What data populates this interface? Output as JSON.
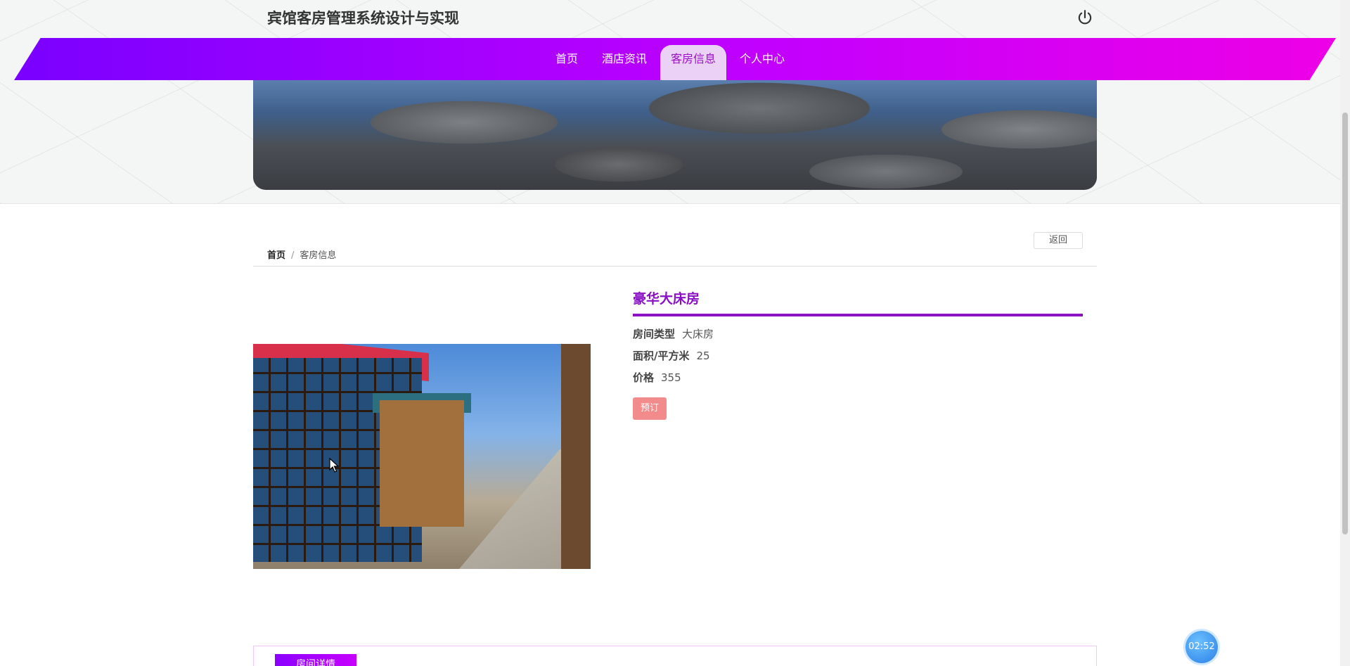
{
  "header": {
    "site_title": "宾馆客房管理系统设计与实现"
  },
  "nav": {
    "items": [
      {
        "label": "首页",
        "active": false
      },
      {
        "label": "酒店资讯",
        "active": false
      },
      {
        "label": "客房信息",
        "active": true
      },
      {
        "label": "个人中心",
        "active": false
      }
    ]
  },
  "breadcrumb": {
    "home": "首页",
    "separator": "/",
    "current": "客房信息"
  },
  "actions": {
    "back_label": "返回",
    "book_label": "预订"
  },
  "room": {
    "name": "豪华大床房",
    "fields": [
      {
        "label": "房间类型",
        "value": "大床房"
      },
      {
        "label": "面积/平方米",
        "value": "25"
      },
      {
        "label": "价格",
        "value": "355"
      }
    ]
  },
  "tabs": {
    "active_label": "房间详情"
  },
  "timer": {
    "value": "02:52"
  },
  "colors": {
    "brand": "#8a10c4",
    "nav_start": "#7a00ff",
    "nav_end": "#ee00e6",
    "book_button": "#f28b8b"
  }
}
